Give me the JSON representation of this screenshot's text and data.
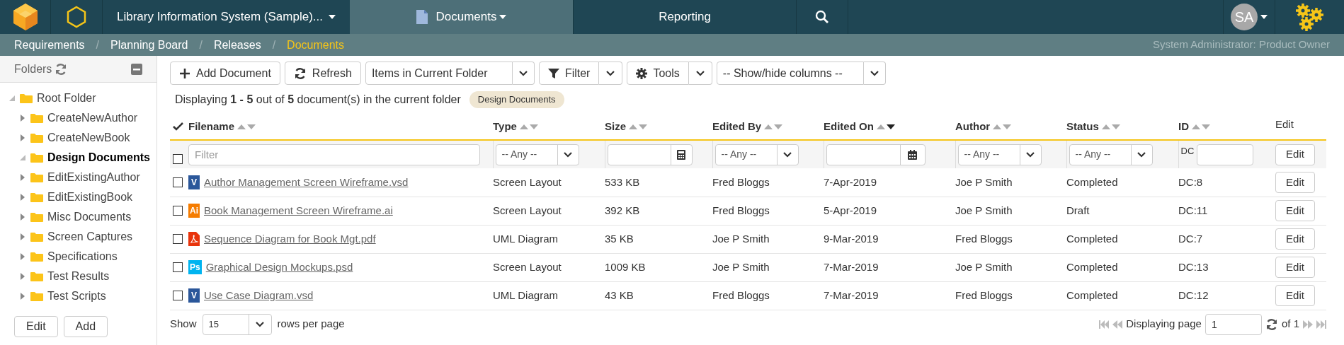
{
  "topbar": {
    "project": "Library Information System (Sample)...",
    "tabs": [
      {
        "label": "Documents",
        "selected": true,
        "dropdown": true
      },
      {
        "label": "Reporting",
        "selected": false,
        "dropdown": false
      }
    ],
    "avatar": "SA"
  },
  "breadcrumbs": [
    {
      "label": "Requirements",
      "current": false
    },
    {
      "separator": "/",
      "label": "Planning Board",
      "current": false
    },
    {
      "separator": "/",
      "label": "Releases",
      "current": false
    },
    {
      "separator": "/",
      "label": "Documents",
      "current": true
    }
  ],
  "user_role": "System Administrator: Product Owner",
  "sidebar": {
    "title": "Folders",
    "folders": [
      {
        "label": "Root Folder",
        "expanded": true,
        "selected": false,
        "children": [
          {
            "label": "CreateNewAuthor",
            "expanded": false,
            "selected": false
          },
          {
            "label": "CreateNewBook",
            "expanded": false,
            "selected": false
          },
          {
            "label": "Design Documents",
            "expanded": true,
            "selected": true
          },
          {
            "label": "EditExistingAuthor",
            "expanded": false,
            "selected": false
          },
          {
            "label": "EditExistingBook",
            "expanded": false,
            "selected": false
          },
          {
            "label": "Misc Documents",
            "expanded": false,
            "selected": false
          },
          {
            "label": "Screen Captures",
            "expanded": false,
            "selected": false
          },
          {
            "label": "Specifications",
            "expanded": false,
            "selected": false
          },
          {
            "label": "Test Results",
            "expanded": false,
            "selected": false
          },
          {
            "label": "Test Scripts",
            "expanded": false,
            "selected": false
          }
        ]
      }
    ],
    "buttons": [
      "Edit",
      "Add"
    ]
  },
  "toolbar": [
    {
      "kind": "add",
      "label": "Add Document"
    },
    {
      "kind": "refresh",
      "label": "Refresh"
    },
    {
      "kind": "select",
      "label": "Items in Current Folder"
    },
    {
      "kind": "filter",
      "label": "Filter"
    },
    {
      "kind": "tools",
      "label": "Tools"
    },
    {
      "kind": "select",
      "label": "-- Show/hide columns --"
    }
  ],
  "summary": "Displaying **1 - 5** out of **5** document(s) in the current folder",
  "folder_tag": "Design Documents",
  "table": {
    "select_all_checked": false,
    "columns": [
      {
        "label": "Filename",
        "sorted_descending": false,
        "filter": {
          "kind": "text",
          "placeholder": "Filter"
        }
      },
      {
        "label": "Type",
        "sorted_descending": false,
        "filter": {
          "kind": "select",
          "value": "-- Any --"
        }
      },
      {
        "label": "Size",
        "sorted_descending": false,
        "filter": {
          "kind": "number"
        }
      },
      {
        "label": "Edited By",
        "sorted_descending": false,
        "filter": {
          "kind": "select",
          "value": "-- Any --"
        }
      },
      {
        "label": "Edited On",
        "sorted_descending": true,
        "filter": {
          "kind": "date"
        }
      },
      {
        "label": "Author",
        "sorted_descending": false,
        "filter": {
          "kind": "select",
          "value": "-- Any --"
        }
      },
      {
        "label": "Status",
        "sorted_descending": false,
        "filter": {
          "kind": "select",
          "value": "-- Any --"
        }
      },
      {
        "label": "ID",
        "sorted_descending": false,
        "filter": {
          "kind": "prefixed",
          "prefix": "DC"
        }
      },
      {
        "label": "Edit",
        "filter": {
          "kind": "button",
          "label": "Edit"
        }
      }
    ],
    "rows": [
      {
        "checked": false,
        "file": {
          "kind": "visio",
          "badge": "V"
        },
        "cells": [
          "Author Management Screen Wireframe.vsd",
          "Screen Layout",
          "533 KB",
          "Fred Bloggs",
          "7-Apr-2019",
          "Joe P Smith",
          "Completed",
          "DC:8"
        ],
        "action": "Edit"
      },
      {
        "checked": false,
        "file": {
          "kind": "illustrator",
          "badge": "Ai"
        },
        "cells": [
          "Book Management Screen Wireframe.ai",
          "Screen Layout",
          "392 KB",
          "Fred Bloggs",
          "5-Apr-2019",
          "Joe P Smith",
          "Draft",
          "DC:11"
        ],
        "action": "Edit"
      },
      {
        "checked": false,
        "file": {
          "kind": "pdf"
        },
        "cells": [
          "Sequence Diagram for Book Mgt.pdf",
          "UML Diagram",
          "35 KB",
          "Joe P Smith",
          "9-Mar-2019",
          "Fred Bloggs",
          "Completed",
          "DC:7"
        ],
        "action": "Edit"
      },
      {
        "checked": false,
        "file": {
          "kind": "photoshop",
          "badge": "Ps"
        },
        "cells": [
          "Graphical Design Mockups.psd",
          "Screen Layout",
          "1009 KB",
          "Joe P Smith",
          "7-Mar-2019",
          "Joe P Smith",
          "Completed",
          "DC:13"
        ],
        "action": "Edit"
      },
      {
        "checked": false,
        "file": {
          "kind": "visio",
          "badge": "V"
        },
        "cells": [
          "Use Case Diagram.vsd",
          "UML Diagram",
          "43 KB",
          "Fred Bloggs",
          "7-Mar-2019",
          "Fred Bloggs",
          "Completed",
          "DC:12"
        ],
        "action": "Edit"
      }
    ]
  },
  "pagination": {
    "show_label": "Show",
    "page_size": "15",
    "rows_label": "rows per page",
    "page_label": "Displaying page",
    "page": "1",
    "of_label": "of 1"
  }
}
